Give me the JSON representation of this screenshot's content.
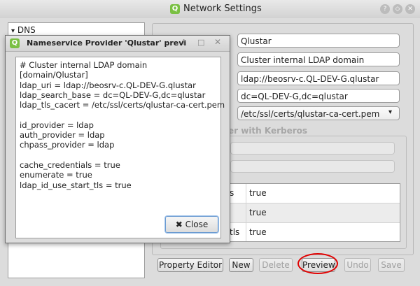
{
  "window": {
    "title": "Network Settings",
    "app_icon": "qlustar-q-icon"
  },
  "tree": {
    "items": [
      {
        "label": "DNS",
        "expanded": true
      }
    ]
  },
  "form": {
    "fields": [
      {
        "label": "",
        "value": "Qlustar"
      },
      {
        "label": "",
        "value": "Cluster internal LDAP domain"
      },
      {
        "label": "",
        "value": "ldap://beosrv-c.QL-DEV-G.qlustar"
      },
      {
        "label": ":",
        "value": "dc=QL-DEV-G,dc=qlustar"
      },
      {
        "label": "",
        "value": "/etc/ssl/certs/qlustar-ca-cert.pem"
      }
    ],
    "group_title": "er with Kerberos",
    "group_title_underlined": "K",
    "table_rows": [
      {
        "key": "s",
        "value": "true"
      },
      {
        "key": "",
        "value": "true"
      },
      {
        "key": "_tls",
        "value": "true"
      }
    ]
  },
  "buttons": {
    "property_editor": "Property Editor",
    "new": "New",
    "delete": "Delete",
    "preview": "Preview",
    "undo": "Undo",
    "save": "Save"
  },
  "dialog": {
    "title": "Nameservice Provider 'Qlustar' previ",
    "config_text": "# Cluster internal LDAP domain\n[domain/Qlustar]\nldap_uri = ldap://beosrv-c.QL-DEV-G.qlustar\nldap_search_base = dc=QL-DEV-G,dc=qlustar\nldap_tls_cacert = /etc/ssl/certs/qlustar-ca-cert.pem\n\nid_provider = ldap\nauth_provider = ldap\nchpass_provider = ldap\n\ncache_credentials = true\nenumerate = true\nldap_id_use_start_tls = true",
    "close_label": "Close"
  },
  "colors": {
    "highlight": "#e00000",
    "accent": "#7ac043"
  }
}
